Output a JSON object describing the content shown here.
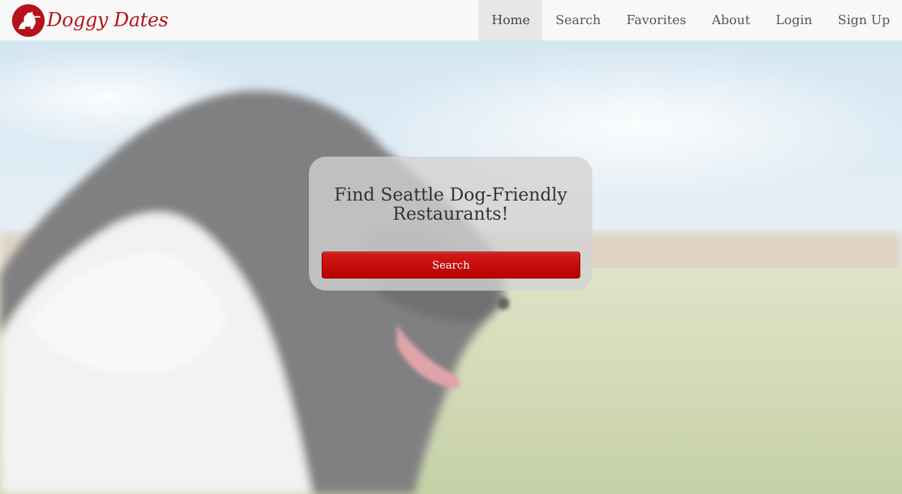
{
  "brand": {
    "name": "Doggy Dates",
    "logo_icon": "dog-silhouette-logo-icon",
    "color": "#b5121b"
  },
  "nav": {
    "items": [
      {
        "label": "Home",
        "active": true
      },
      {
        "label": "Search",
        "active": false
      },
      {
        "label": "Favorites",
        "active": false
      },
      {
        "label": "About",
        "active": false
      },
      {
        "label": "Login",
        "active": false
      },
      {
        "label": "Sign Up",
        "active": false
      }
    ]
  },
  "hero": {
    "background": "border-collie-in-field-photo",
    "title": "Find Seattle Dog-Friendly Restaurants!",
    "search_label": "Search",
    "button_color": "#c00000"
  }
}
